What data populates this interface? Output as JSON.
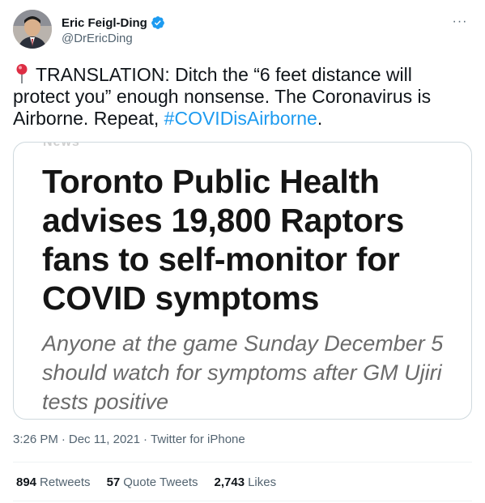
{
  "author": {
    "display_name": "Eric Feigl-Ding",
    "handle": "@DrEricDing",
    "verified_icon": "verified-badge-icon",
    "accent_color": "#1d9bf0"
  },
  "more_menu": {
    "label": "···"
  },
  "tweet": {
    "text_before_hashtag": "TRANSLATION: Ditch the “6 feet distance will protect you” enough nonsense. The Coronavirus is Airborne. Repeat, ",
    "hashtag": "#COVIDisAirborne",
    "text_after_hashtag": ".",
    "lead_icon": "round-pushpin-icon"
  },
  "media": {
    "top_cut_text": "News",
    "headline": "Toronto Public Health advises 19,800 Raptors fans to self-monitor for COVID symptoms",
    "subhead": "Anyone at the game Sunday December 5 should watch for symptoms after GM Ujiri tests positive"
  },
  "meta": {
    "time": "3:26 PM",
    "separator": "·",
    "date": "Dec 11, 2021",
    "source": "Twitter for iPhone"
  },
  "stats": {
    "retweets_count": "894",
    "retweets_label": "Retweets",
    "quotes_count": "57",
    "quotes_label": "Quote Tweets",
    "likes_count": "2,743",
    "likes_label": "Likes"
  }
}
